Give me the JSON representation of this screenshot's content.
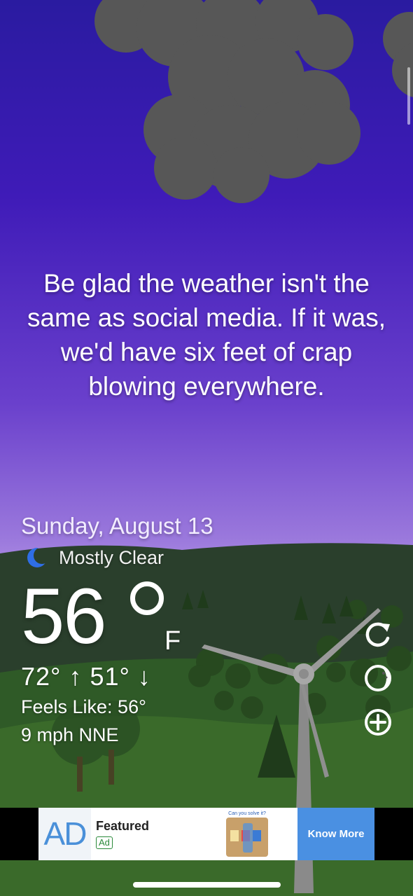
{
  "quote": {
    "text": "Be glad the weather isn't the same as social media. If it was, we'd have six feet of crap blowing everywhere."
  },
  "weather": {
    "date": "Sunday, August 13",
    "condition": "Mostly Clear",
    "condition_icon": "crescent-moon-icon",
    "temperature": "56",
    "unit": "F",
    "high_low": "72° ↑ 51° ↓",
    "feels_like": "Feels Like: 56°",
    "wind": "9 mph NNE"
  },
  "controls": {
    "refresh_icon": "refresh-icon",
    "theme_icon": "moon-phase-icon",
    "add_icon": "add-location-icon"
  },
  "ad": {
    "logo": "AD",
    "title": "Featured",
    "tag": "Ad",
    "image_caption": "Can you solve it?",
    "cta": "Know More"
  },
  "colors": {
    "sky_top": "#2a1ba0",
    "sky_horizon": "#b797e8",
    "hills": "#2c4a2b",
    "ad_cta": "#4a90e2"
  }
}
